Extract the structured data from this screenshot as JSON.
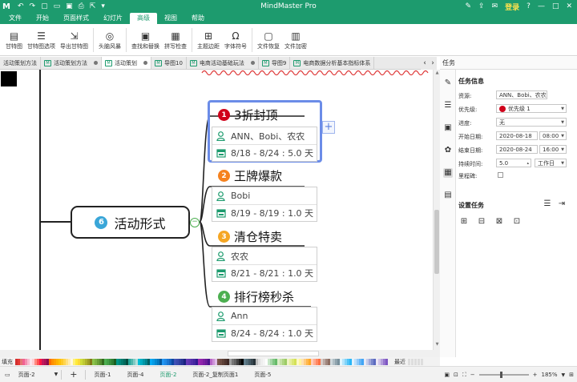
{
  "app": {
    "title": "MindMaster Pro",
    "logo": "M",
    "login_label": "登录"
  },
  "menus": [
    "文件",
    "开始",
    "页面样式",
    "幻灯片",
    "高级",
    "视图",
    "帮助"
  ],
  "active_menu": 4,
  "ribbon": {
    "buttons": [
      {
        "label": "甘特图",
        "icon": "gantt-icon",
        "glyph": "▤"
      },
      {
        "label": "甘特图选项",
        "icon": "gantt-options-icon",
        "glyph": "☰"
      },
      {
        "label": "导出甘特图",
        "icon": "export-gantt-icon",
        "glyph": "⇲"
      },
      {
        "label": "头脑风暴",
        "icon": "lightbulb-icon",
        "glyph": "◎"
      },
      {
        "label": "查找和替换",
        "icon": "find-replace-icon",
        "glyph": "▣"
      },
      {
        "label": "拼写检查",
        "icon": "spell-check-icon",
        "glyph": "▦"
      },
      {
        "label": "主题边距",
        "icon": "topic-margin-icon",
        "glyph": "⊞"
      },
      {
        "label": "字体符号",
        "icon": "symbol-icon",
        "glyph": "Ω"
      },
      {
        "label": "文件恢复",
        "icon": "file-recover-icon",
        "glyph": "▢"
      },
      {
        "label": "文件加密",
        "icon": "file-encrypt-icon",
        "glyph": "▥"
      }
    ]
  },
  "doc_tabs": [
    {
      "label": "活动策划方法",
      "icon": false,
      "dot": false
    },
    {
      "label": "活动策划方法",
      "icon": true,
      "dot": true
    },
    {
      "label": "活动策划",
      "icon": true,
      "dot": true,
      "active": true
    },
    {
      "label": "导图10",
      "icon": true,
      "dot": false
    },
    {
      "label": "电商活动基础玩法",
      "icon": true,
      "dot": true
    },
    {
      "label": "导图9",
      "icon": true,
      "dot": false
    },
    {
      "label": "电商数据分析基本指标体系",
      "icon": true,
      "dot": false
    }
  ],
  "mindmap": {
    "main_topic": {
      "number": "6",
      "label": "活动形式"
    },
    "subtopics": [
      {
        "number": "1",
        "color": "#d0021b",
        "title": "3折封顶",
        "resource": "ANN、Bobi、农农",
        "dates": "8/18 - 8/24 : 5.0 天"
      },
      {
        "number": "2",
        "color": "#f5821f",
        "title": "王牌爆款",
        "resource": "Bobi",
        "dates": "8/19 - 8/19 : 1.0 天"
      },
      {
        "number": "3",
        "color": "#f5a623",
        "title": "清仓特卖",
        "resource": "农农",
        "dates": "8/21 - 8/21 : 1.0 天"
      },
      {
        "number": "4",
        "color": "#4caf50",
        "title": "排行榜秒杀",
        "resource": "Ann",
        "dates": "8/24 - 8/24 : 1.0 天"
      }
    ],
    "add_button": "+"
  },
  "task_panel": {
    "header": "任务",
    "section_info": "任务信息",
    "resource_label": "资源:",
    "resource_value": "ANN、Bobi、农农",
    "priority_label": "优先级:",
    "priority_value": "优先级 1",
    "progress_label": "进度:",
    "progress_value": "无",
    "start_label": "开始日期:",
    "start_date": "2020-08-18",
    "start_time": "08:00",
    "end_label": "结束日期:",
    "end_date": "2020-08-24",
    "end_time": "16:00",
    "duration_label": "持续时间:",
    "duration_value": "5.0",
    "duration_unit": "工作日",
    "milestone_label": "里程碑:",
    "section_settings": "设置任务"
  },
  "palette": {
    "fill_label": "填充",
    "recent_label": "最近",
    "colors": [
      "#d32f2f",
      "#e53935",
      "#e57373",
      "#f06292",
      "#f48fb1",
      "#f8bbd0",
      "#fce4ec",
      "#ffcdd2",
      "#ff8a80",
      "#ff5252",
      "#ff1744",
      "#c2185b",
      "#ad1457",
      "#880e4f",
      "#ff6f00",
      "#ff8f00",
      "#ffa000",
      "#ffb300",
      "#ffc107",
      "#ffca28",
      "#ffd54f",
      "#ffe082",
      "#ffecb3",
      "#fff8e1",
      "#fff176",
      "#ffeb3b",
      "#fdd835",
      "#cddc39",
      "#c0ca33",
      "#afb42b",
      "#9e9d24",
      "#827717",
      "#8bc34a",
      "#7cb342",
      "#689f38",
      "#558b2f",
      "#33691e",
      "#4caf50",
      "#43a047",
      "#388e3c",
      "#2e7d32",
      "#1b5e20",
      "#009688",
      "#00897b",
      "#00796b",
      "#00695c",
      "#004d40",
      "#26a69a",
      "#4db6ac",
      "#80cbc4",
      "#b2dfdb",
      "#00bcd4",
      "#00acc1",
      "#0097a7",
      "#00838f",
      "#006064",
      "#03a9f4",
      "#039be5",
      "#0288d1",
      "#0277bd",
      "#01579b",
      "#2196f3",
      "#1e88e5",
      "#1976d2",
      "#1565c0",
      "#0d47a1",
      "#3f51b5",
      "#3949ab",
      "#303f9f",
      "#283593",
      "#1a237e",
      "#673ab7",
      "#5e35b1",
      "#512da8",
      "#4527a0",
      "#311b92",
      "#9c27b0",
      "#8e24aa",
      "#7b1fa2",
      "#6a1b9a",
      "#4a148c",
      "#ba68c8",
      "#ce93d8",
      "#e1bee7",
      "#795548",
      "#6d4c41",
      "#5d4037",
      "#4e342e",
      "#3e2723",
      "#9e9e9e",
      "#757575",
      "#616161",
      "#424242",
      "#212121",
      "#000000",
      "#607d8b",
      "#546e7a",
      "#455a64",
      "#37474f",
      "#263238",
      "#bdbdbd",
      "#e0e0e0",
      "#eeeeee",
      "#f5f5f5",
      "#ffffff",
      "#c8e6c9",
      "#a5d6a7",
      "#81c784",
      "#66bb6a",
      "#dcedc8",
      "#c5e1a5",
      "#aed581",
      "#9ccc65",
      "#f0f4c3",
      "#e6ee9c",
      "#dce775",
      "#d4e157",
      "#fff9c4",
      "#fff59d",
      "#ffe0b2",
      "#ffcc80",
      "#ffb74d",
      "#ffa726",
      "#ffccbc",
      "#ffab91",
      "#ff8a65",
      "#ff7043",
      "#d7ccc8",
      "#bcaaa4",
      "#a1887f",
      "#8d6e63",
      "#cfd8dc",
      "#b0bec5",
      "#90a4ae",
      "#78909c",
      "#e1f5fe",
      "#b3e5fc",
      "#81d4fa",
      "#4fc3f7",
      "#29b6f6",
      "#e3f2fd",
      "#bbdefb",
      "#90caf9",
      "#64b5f6",
      "#42a5f5",
      "#e8eaf6",
      "#c5cae9",
      "#9fa8da",
      "#7986cb",
      "#5c6bc0",
      "#ede7f6",
      "#d1c4e9",
      "#b39ddb",
      "#9575cd",
      "#7e57c2"
    ]
  },
  "status": {
    "page_select": "页面-2",
    "add_page": "+",
    "pages": [
      "页面-1",
      "页面-4",
      "页面-2",
      "页面-2_复制页面1",
      "页面-5"
    ],
    "active_page": 2,
    "zoom": "185%"
  }
}
